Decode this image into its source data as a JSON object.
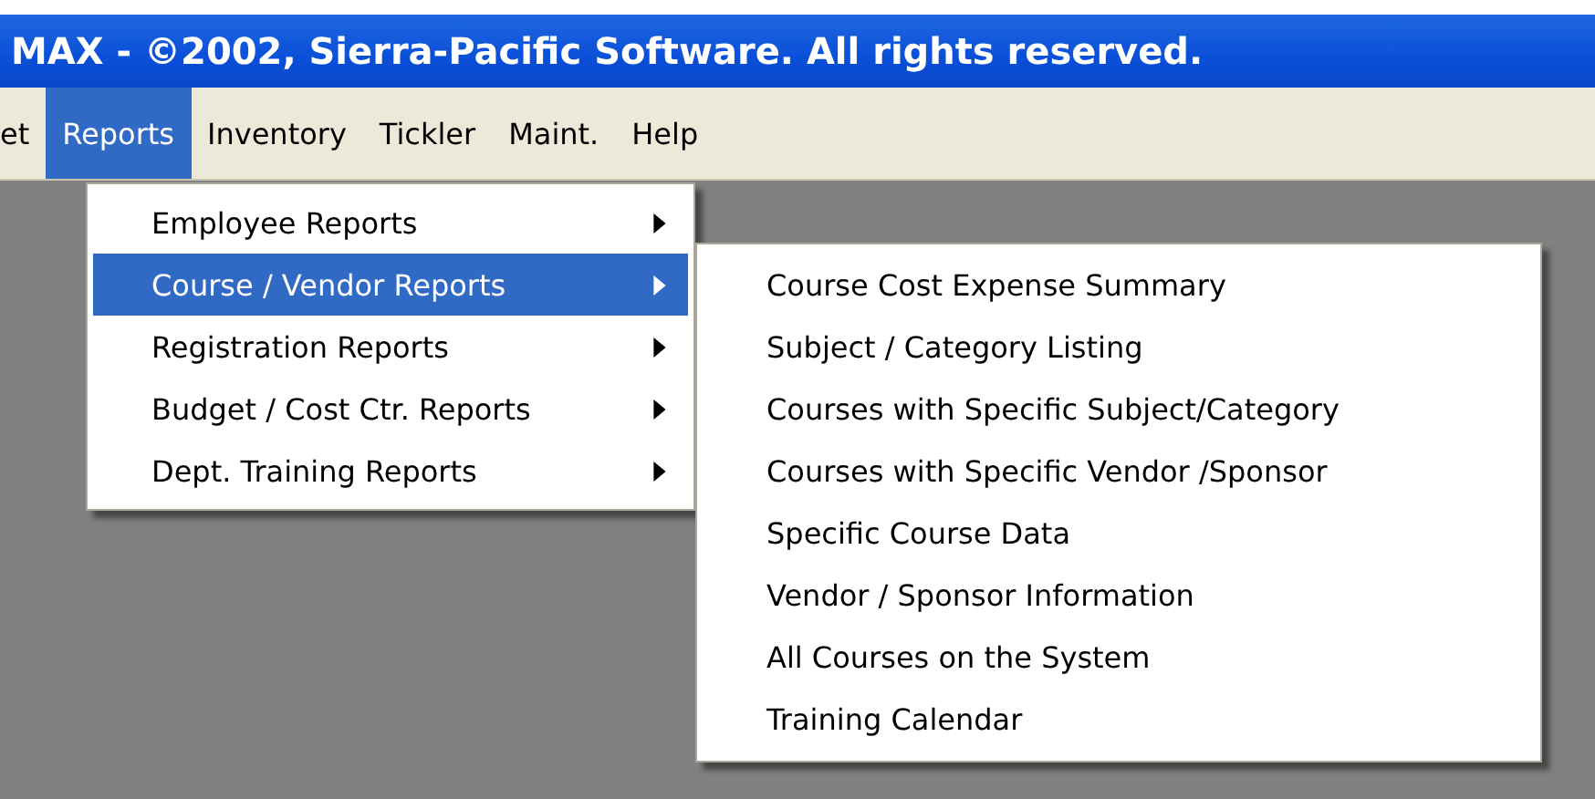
{
  "window": {
    "title": "MAX - ©2002, Sierra-Pacific Software. All rights reserved."
  },
  "menu_bar": [
    {
      "label": "et",
      "selected": false
    },
    {
      "label": "Reports",
      "selected": true
    },
    {
      "label": "Inventory",
      "selected": false
    },
    {
      "label": "Tickler",
      "selected": false
    },
    {
      "label": "Maint.",
      "selected": false
    },
    {
      "label": "Help",
      "selected": false
    }
  ],
  "reports_menu": [
    {
      "label": "Employee Reports",
      "selected": false
    },
    {
      "label": "Course / Vendor Reports",
      "selected": true
    },
    {
      "label": "Registration Reports",
      "selected": false
    },
    {
      "label": "Budget / Cost Ctr. Reports",
      "selected": false
    },
    {
      "label": "Dept. Training Reports",
      "selected": false
    }
  ],
  "submenu": [
    "Course Cost Expense Summary",
    "Subject / Category Listing",
    "Courses with Specific Subject/Category",
    "Courses with Specific Vendor /Sponsor",
    "Specific Course Data",
    "Vendor / Sponsor Information",
    "All Courses on the System",
    "Training Calendar"
  ]
}
